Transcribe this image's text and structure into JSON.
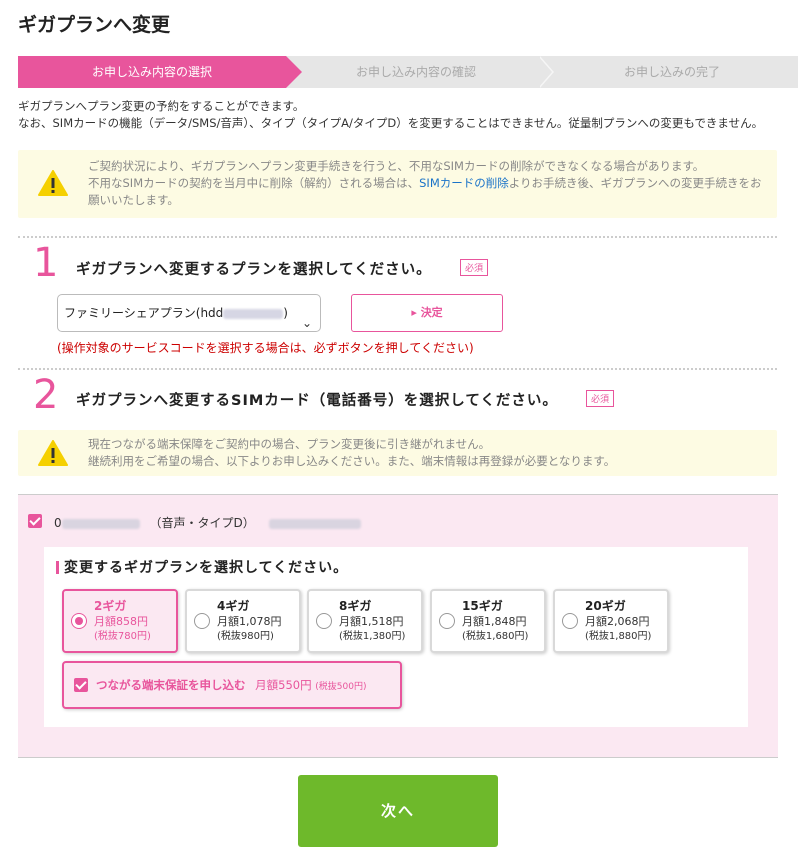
{
  "page": {
    "title": "ギガプランへ変更"
  },
  "steps": [
    {
      "label": "お申し込み内容の選択"
    },
    {
      "label": "お申し込み内容の確認"
    },
    {
      "label": "お申し込みの完了"
    }
  ],
  "intro": {
    "line1": "ギガプランへプラン変更の予約をすることができます。",
    "line2": "なお、SIMカードの機能（データ/SMS/音声）、タイプ（タイプA/タイプD）を変更することはできません。従量制プランへの変更もできません。"
  },
  "warning1": {
    "line1": "ご契約状況により、ギガプランへプラン変更手続きを行うと、不用なSIMカードの削除ができなくなる場合があります。",
    "line2_pre": "不用なSIMカードの契約を当月中に削除（解約）される場合は、",
    "link": "SIMカードの削除",
    "line2_post": "よりお手続き後、ギガプランへの変更手続きをお",
    "line3": "願いいたします。"
  },
  "section1": {
    "number": "1",
    "title": "ギガプランへ変更するプランを選択してください。",
    "required": "必須",
    "select_value": "ファミリーシェアプラン(hdd",
    "select_value_end": ")",
    "decide_label": "決定",
    "note": "(操作対象のサービスコードを選択する場合は、必ずボタンを押してください)"
  },
  "section2": {
    "number": "2",
    "title": "ギガプランへ変更するSIMカード（電話番号）を選択してください。",
    "required": "必須"
  },
  "warning2": {
    "line1": "現在つながる端末保障をご契約中の場合、プラン変更後に引き継がれません。",
    "line2": "継続利用をご希望の場合、以下よりお申し込みください。また、端末情報は再登録が必要となります。"
  },
  "sim": {
    "number_prefix": "0",
    "type": "（音声・タイプD）"
  },
  "plan_select": {
    "title": "変更するギガプランを選択してください。",
    "plans": [
      {
        "name": "2ギガ",
        "price": "月額858円",
        "tax": "(税抜780円)",
        "selected": true
      },
      {
        "name": "4ギガ",
        "price": "月額1,078円",
        "tax": "(税抜980円)",
        "selected": false
      },
      {
        "name": "8ギガ",
        "price": "月額1,518円",
        "tax": "(税抜1,380円)",
        "selected": false
      },
      {
        "name": "15ギガ",
        "price": "月額1,848円",
        "tax": "(税抜1,680円)",
        "selected": false
      },
      {
        "name": "20ギガ",
        "price": "月額2,068円",
        "tax": "(税抜1,880円)",
        "selected": false
      }
    ],
    "guarantee": {
      "label": "つながる端末保証を申し込む",
      "price": "月額550円",
      "tax": "(税抜500円)"
    }
  },
  "next_label": "次へ",
  "colors": {
    "accent": "#e8559c",
    "green": "#6eb92b",
    "warn_bg": "#fdfbe3",
    "sim_bg": "#fbe8f2",
    "error": "#cc0000",
    "link": "#1a73c8"
  }
}
